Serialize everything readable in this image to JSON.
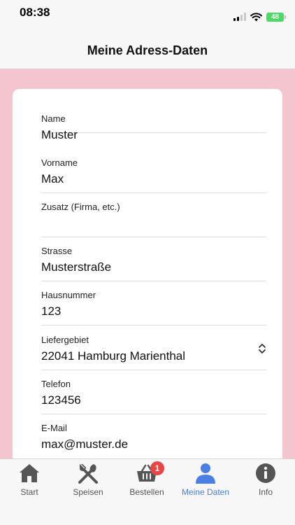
{
  "status_bar": {
    "time": "08:38",
    "battery": "48"
  },
  "header": {
    "title": "Meine Adress-Daten"
  },
  "form": {
    "fields": [
      {
        "label": "Name",
        "value": "Muster"
      },
      {
        "label": "Vorname",
        "value": "Max"
      },
      {
        "label": "Zusatz (Firma, etc.)",
        "value": ""
      },
      {
        "label": "Strasse",
        "value": "Musterstraße"
      },
      {
        "label": "Hausnummer",
        "value": "123"
      },
      {
        "label": "Liefergebiet",
        "value": "22041 Hamburg Marienthal"
      },
      {
        "label": "Telefon",
        "value": "123456"
      },
      {
        "label": "E-Mail",
        "value": "max@muster.de"
      }
    ]
  },
  "tabbar": {
    "active_color": "#4a7fe6",
    "tabs": [
      {
        "label": "Start",
        "icon": "home-icon"
      },
      {
        "label": "Speisen",
        "icon": "cutlery-icon"
      },
      {
        "label": "Bestellen",
        "icon": "basket-icon",
        "badge": "1"
      },
      {
        "label": "Meine Daten",
        "icon": "user-icon"
      },
      {
        "label": "Info",
        "icon": "info-icon"
      }
    ]
  }
}
